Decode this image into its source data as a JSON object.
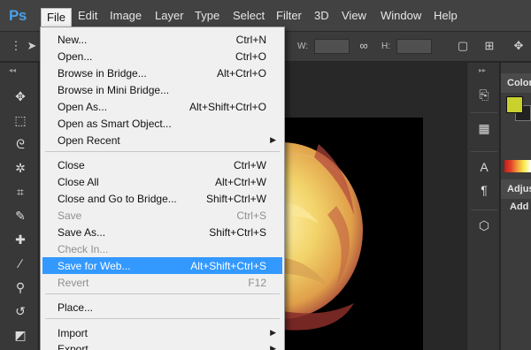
{
  "app_logo": "Ps",
  "menubar": [
    "File",
    "Edit",
    "Image",
    "Layer",
    "Type",
    "Select",
    "Filter",
    "3D",
    "View",
    "Window",
    "Help"
  ],
  "options_bar": {
    "w_label": "W:",
    "h_label": "H:"
  },
  "file_menu": {
    "items": [
      {
        "label": "New...",
        "shortcut": "Ctrl+N",
        "disabled": false
      },
      {
        "label": "Open...",
        "shortcut": "Ctrl+O",
        "disabled": false
      },
      {
        "label": "Browse in Bridge...",
        "shortcut": "Alt+Ctrl+O",
        "disabled": false
      },
      {
        "label": "Browse in Mini Bridge...",
        "shortcut": "",
        "disabled": false
      },
      {
        "label": "Open As...",
        "shortcut": "Alt+Shift+Ctrl+O",
        "disabled": false
      },
      {
        "label": "Open as Smart Object...",
        "shortcut": "",
        "disabled": false
      },
      {
        "label": "Open Recent",
        "shortcut": "",
        "submenu": true,
        "disabled": false
      },
      {
        "label": "Close",
        "shortcut": "Ctrl+W",
        "disabled": false
      },
      {
        "label": "Close All",
        "shortcut": "Alt+Ctrl+W",
        "disabled": false
      },
      {
        "label": "Close and Go to Bridge...",
        "shortcut": "Shift+Ctrl+W",
        "disabled": false
      },
      {
        "label": "Save",
        "shortcut": "Ctrl+S",
        "disabled": true
      },
      {
        "label": "Save As...",
        "shortcut": "Shift+Ctrl+S",
        "disabled": false
      },
      {
        "label": "Check In...",
        "shortcut": "",
        "disabled": true
      },
      {
        "label": "Save for Web...",
        "shortcut": "Alt+Shift+Ctrl+S",
        "disabled": false,
        "highlighted": true
      },
      {
        "label": "Revert",
        "shortcut": "F12",
        "disabled": true
      },
      {
        "label": "Place...",
        "shortcut": "",
        "disabled": false
      },
      {
        "label": "Import",
        "shortcut": "",
        "submenu": true,
        "disabled": false
      },
      {
        "label": "Export",
        "shortcut": "",
        "submenu": true,
        "disabled": false
      }
    ]
  },
  "right_panel": {
    "color_tab": "Color",
    "adjustments_tab": "Adjus",
    "adjustments_label": "Add a",
    "foreground_color": "#c9d12e"
  },
  "colors": {
    "menu_highlight": "#3399ff",
    "logo_blue": "#49a0e9"
  }
}
